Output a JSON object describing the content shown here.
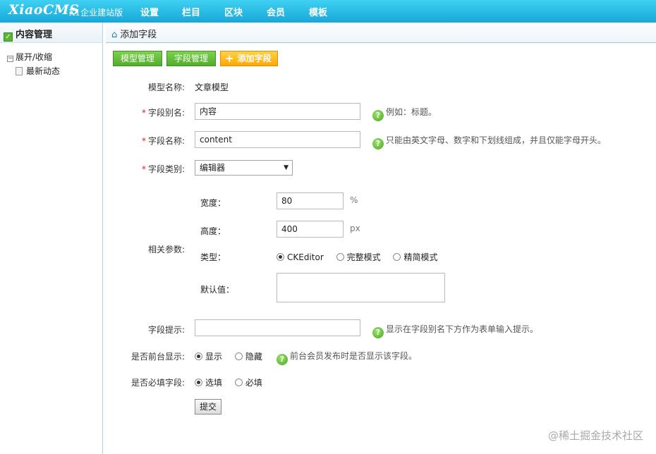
{
  "topbar": {
    "logo": "XiaoCMS",
    "logo_sub": "X1企业建站版",
    "nav": [
      "设置",
      "栏目",
      "区块",
      "会员",
      "模板"
    ]
  },
  "sidebar": {
    "title": "内容管理",
    "tree": {
      "root": "展开/收缩",
      "child": "最新动态"
    }
  },
  "breadcrumb": "添加字段",
  "actions": {
    "model_manage": "模型管理",
    "field_manage": "字段管理",
    "add_field": "添加字段"
  },
  "form": {
    "model_name_label": "模型名称:",
    "model_name_value": "文章模型",
    "alias_label": "字段别名:",
    "alias_value": "内容",
    "alias_hint": "例如：标题。",
    "name_label": "字段名称:",
    "name_value": "content",
    "name_hint": "只能由英文字母、数字和下划线组成，并且仅能字母开头。",
    "type_label": "字段类别:",
    "type_value": "编辑器",
    "params_label": "相关参数:",
    "width_label": "宽度：",
    "width_value": "80",
    "width_unit": "%",
    "height_label": "高度：",
    "height_value": "400",
    "height_unit": "px",
    "editor_type_label": "类型：",
    "editor_types": [
      "CKEditor",
      "完整模式",
      "精简模式"
    ],
    "editor_type_selected": 0,
    "default_label": "默认值：",
    "tip_label": "字段提示:",
    "tip_hint": "显示在字段别名下方作为表单输入提示。",
    "show_label": "是否前台显示:",
    "show_options": [
      "显示",
      "隐藏"
    ],
    "show_selected": 0,
    "show_hint": "前台会员发布时是否显示该字段。",
    "required_label": "是否必填字段:",
    "required_options": [
      "选填",
      "必填"
    ],
    "required_selected": 0,
    "submit_label": "提交"
  },
  "watermark": "@稀土掘金技术社区"
}
